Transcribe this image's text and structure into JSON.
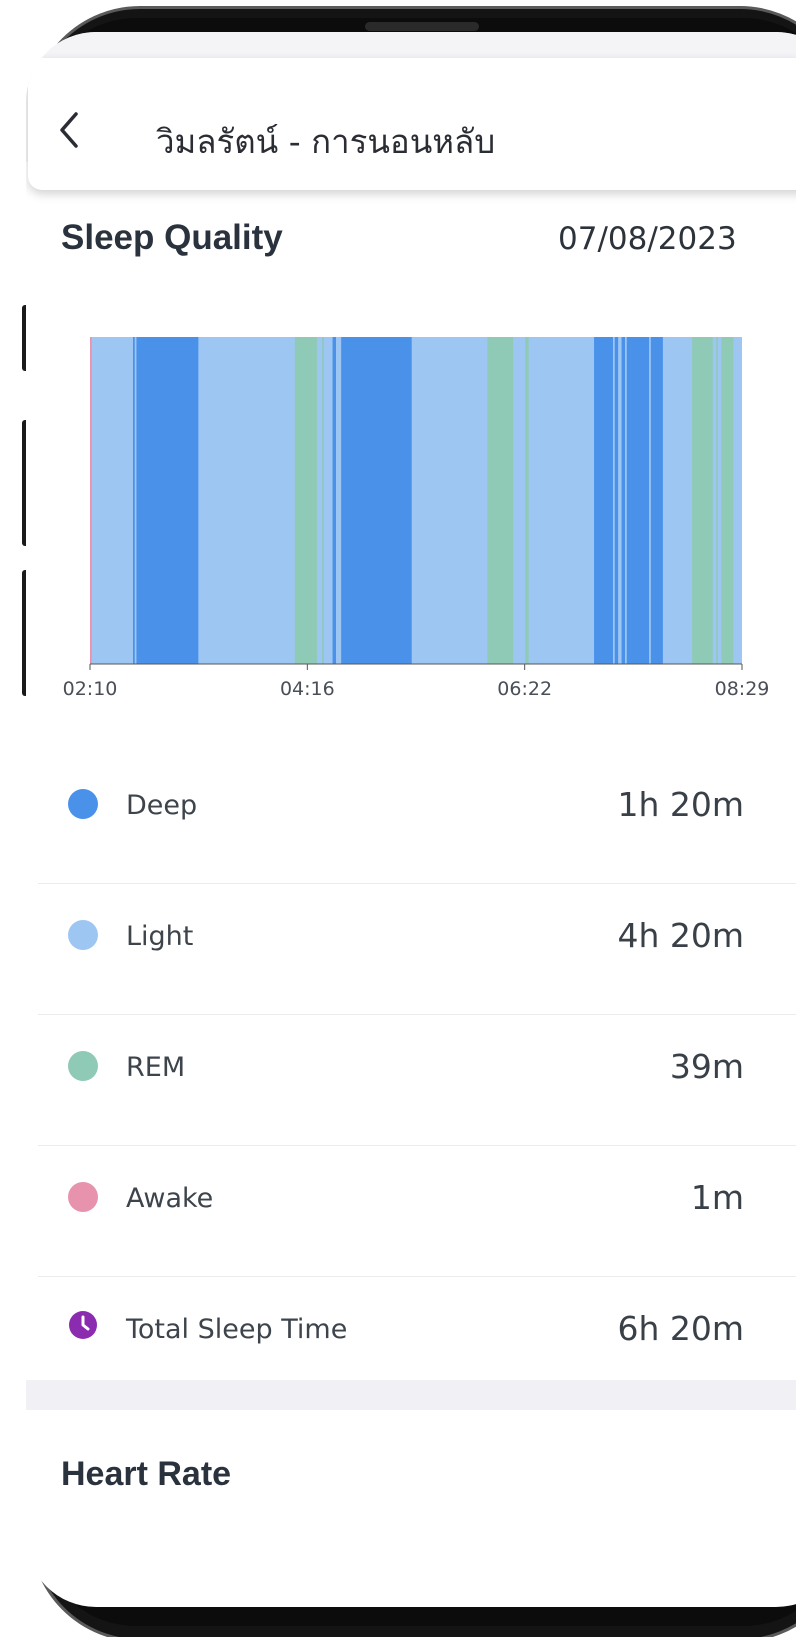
{
  "header": {
    "title": "วิมลรัตน์ - การนอนหลับ",
    "back_icon": "chevron-left-icon"
  },
  "sleep_quality": {
    "title": "Sleep Quality",
    "date": "07/08/2023"
  },
  "colors": {
    "deep": "#4a91ea",
    "light": "#9ec6f3",
    "rem": "#8fcab6",
    "awake": "#e893ae",
    "total": "#8b2bb0",
    "axis": "#555555"
  },
  "chart_data": {
    "type": "timeline",
    "x_ticks": [
      "02:10",
      "04:16",
      "06:22",
      "08:29"
    ],
    "x_range": [
      "02:10",
      "08:29"
    ],
    "background_stage": "light",
    "segments": [
      {
        "stage": "awake",
        "start": "02:10",
        "end": "02:11"
      },
      {
        "stage": "deep",
        "start": "02:35",
        "end": "02:36"
      },
      {
        "stage": "deep",
        "start": "02:37",
        "end": "03:13"
      },
      {
        "stage": "rem",
        "start": "04:09",
        "end": "04:22"
      },
      {
        "stage": "rem",
        "start": "04:25",
        "end": "04:26"
      },
      {
        "stage": "deep",
        "start": "04:31",
        "end": "04:33"
      },
      {
        "stage": "deep",
        "start": "04:36",
        "end": "05:17"
      },
      {
        "stage": "rem",
        "start": "06:01",
        "end": "06:16"
      },
      {
        "stage": "rem",
        "start": "06:23",
        "end": "06:25"
      },
      {
        "stage": "deep",
        "start": "07:03",
        "end": "07:14"
      },
      {
        "stage": "deep",
        "start": "07:15",
        "end": "07:17"
      },
      {
        "stage": "deep",
        "start": "07:19",
        "end": "07:21"
      },
      {
        "stage": "deep",
        "start": "07:22",
        "end": "07:35"
      },
      {
        "stage": "deep",
        "start": "07:36",
        "end": "07:43"
      },
      {
        "stage": "rem",
        "start": "08:00",
        "end": "08:12"
      },
      {
        "stage": "rem",
        "start": "08:14",
        "end": "08:15"
      },
      {
        "stage": "rem",
        "start": "08:17",
        "end": "08:24"
      }
    ]
  },
  "stages": [
    {
      "key": "deep",
      "label": "Deep",
      "value": "1h 20m"
    },
    {
      "key": "light",
      "label": "Light",
      "value": "4h 20m"
    },
    {
      "key": "rem",
      "label": "REM",
      "value": "39m"
    },
    {
      "key": "awake",
      "label": "Awake",
      "value": "1m"
    },
    {
      "key": "total",
      "label": "Total Sleep Time",
      "value": "6h 20m",
      "icon": "clock-icon"
    }
  ],
  "heart_rate": {
    "title": "Heart Rate"
  }
}
